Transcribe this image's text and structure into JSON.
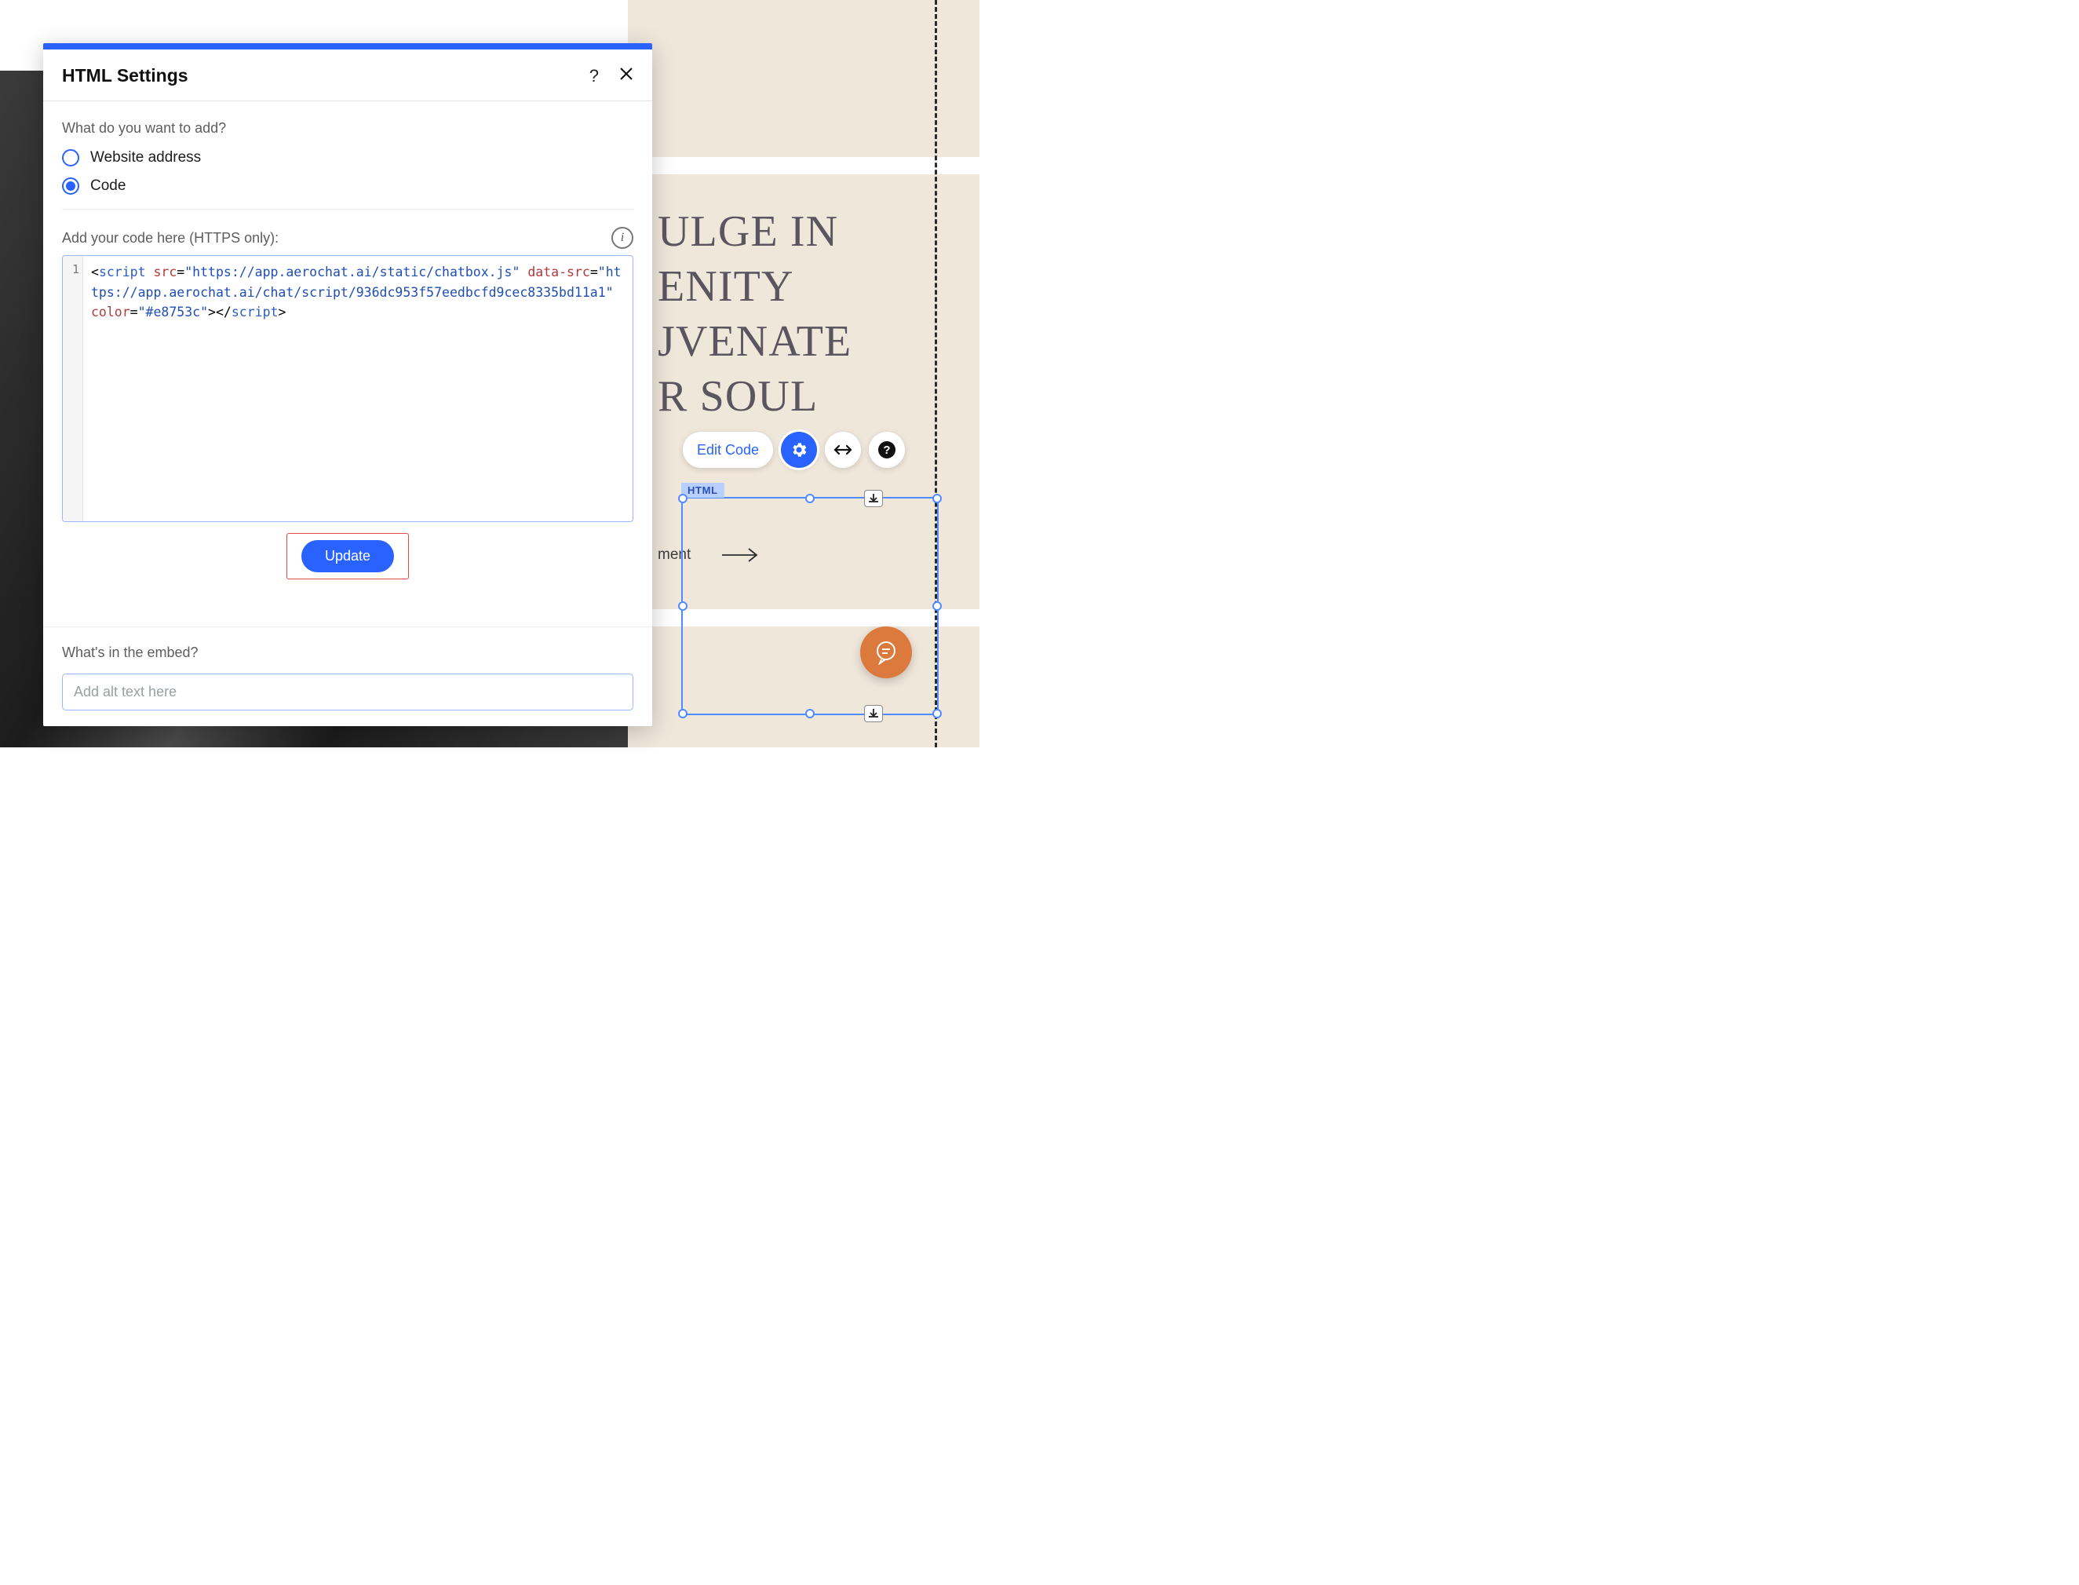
{
  "background": {
    "headline": "ULGE IN\nENITY\nJVENATE\nR SOUL",
    "subline": "ment",
    "toolbar": {
      "edit_label": "Edit Code"
    },
    "selection_tag": "HTML"
  },
  "modal": {
    "title": "HTML Settings",
    "q_label": "What do you want to add?",
    "option_url": "Website address",
    "option_code": "Code",
    "selected_option": "code",
    "code_label": "Add your code here (HTTPS only):",
    "line_number": "1",
    "code_tokens": {
      "t1": "<",
      "t2": "script",
      "t3": " ",
      "a1": "src",
      "eq": "=",
      "q": "\"",
      "v1": "https://app.aerochat.ai/static/chatbox.js",
      "a2": "data-src",
      "v2": "https://app.aerochat.ai/chat/script/936dc953f57eedbcfd9cec8335bd11a1",
      "a3": "color",
      "v3": "#e8753c",
      "t4": ">",
      "t5": "</",
      "t6": "script",
      "t7": ">"
    },
    "update_label": "Update",
    "embed_label": "What's in the embed?",
    "alt_placeholder": "Add alt text here"
  }
}
